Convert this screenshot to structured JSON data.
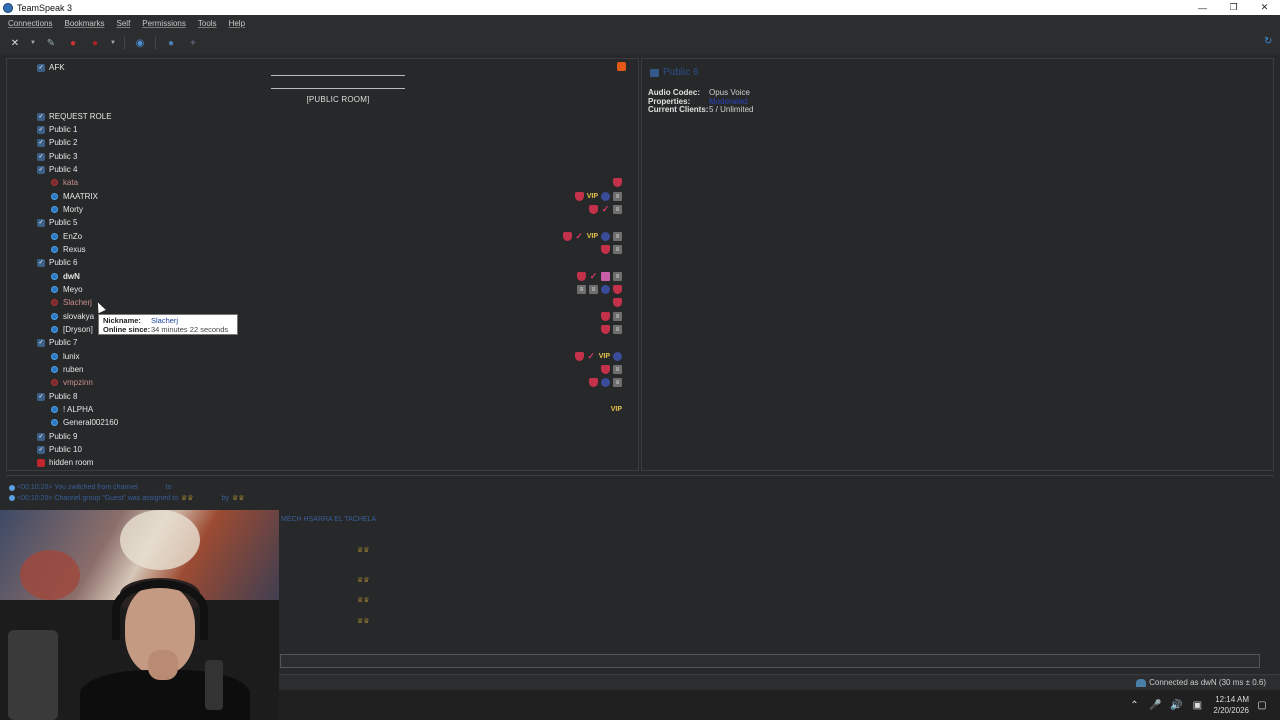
{
  "window": {
    "title": "TeamSpeak 3"
  },
  "menu": [
    "Connections",
    "Bookmarks",
    "Self",
    "Permissions",
    "Tools",
    "Help"
  ],
  "tree": {
    "banner": "[PUBLIC ROOM]",
    "rows": [
      {
        "type": "channel",
        "label": "AFK",
        "top": 0
      },
      {
        "type": "channel",
        "label": "REQUEST ROLE"
      },
      {
        "type": "channel",
        "label": "Public 1"
      },
      {
        "type": "channel",
        "label": "Public 2"
      },
      {
        "type": "channel",
        "label": "Public 3"
      },
      {
        "type": "channel",
        "label": "Public 4"
      },
      {
        "type": "user",
        "label": "kata",
        "away": true
      },
      {
        "type": "user",
        "label": "MAATRIX"
      },
      {
        "type": "user",
        "label": "Morty"
      },
      {
        "type": "channel",
        "label": "Public 5"
      },
      {
        "type": "user",
        "label": "EnZo"
      },
      {
        "type": "user",
        "label": "Rexus"
      },
      {
        "type": "channel",
        "label": "Public 6"
      },
      {
        "type": "user",
        "label": "dwN",
        "bold": true
      },
      {
        "type": "user",
        "label": "Meyo"
      },
      {
        "type": "user",
        "label": "Slacherj",
        "away": true
      },
      {
        "type": "user",
        "label": "slovakya"
      },
      {
        "type": "user",
        "label": "[Dryson]"
      },
      {
        "type": "channel",
        "label": "Public 7"
      },
      {
        "type": "user",
        "label": "lunix"
      },
      {
        "type": "user",
        "label": "ruben"
      },
      {
        "type": "user",
        "label": "vmpzinn",
        "away": true
      },
      {
        "type": "channel",
        "label": "Public 8"
      },
      {
        "type": "user",
        "label": "! ALPHA"
      },
      {
        "type": "user",
        "label": "General002160"
      },
      {
        "type": "channel",
        "label": "Public 9"
      },
      {
        "type": "channel",
        "label": "Public 10"
      },
      {
        "type": "channel",
        "label": "hidden room",
        "red": true
      }
    ],
    "badge_vip": "VIP"
  },
  "tooltip": {
    "nickname_key": "Nickname:",
    "nickname_val": "Slacherj",
    "online_key": "Online since:",
    "online_val": "34 minutes 22 seconds"
  },
  "info": {
    "title": "Public 6",
    "audio_codec_key": "Audio Codec:",
    "audio_codec_val": "Opus Voice",
    "properties_key": "Properties:",
    "properties_val": "Moderated",
    "clients_key": "Current Clients:",
    "clients_val": "5 / Unlimited"
  },
  "chat": {
    "line1": "<00:10:20> You switched from channel",
    "line1b": "to",
    "line2": "<00:10:20> Channel group \"Guest\" was assigned to",
    "line2b": "by",
    "line3": "MECH HSARRA EL TACHELA"
  },
  "status": {
    "connected": "Connected as dwN (30 ms ± 0.6)"
  },
  "taskbar": {
    "time": "12:14 AM",
    "date": "2/20/2026"
  },
  "colors": {
    "accent": "#2a79c2",
    "bg": "#262829",
    "away": "#c0272d"
  }
}
